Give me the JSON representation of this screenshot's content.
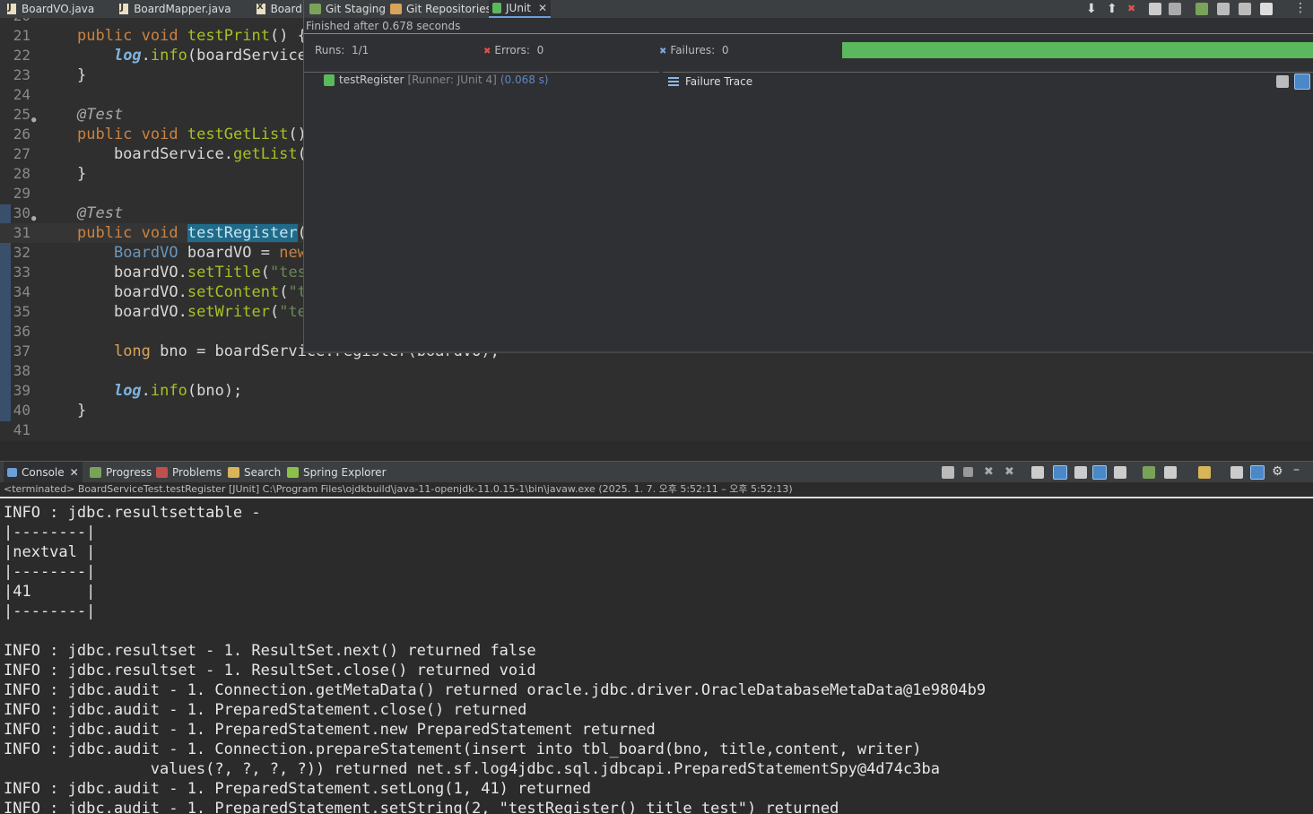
{
  "editor_tabs": [
    {
      "label": "BoardVO.java",
      "icon": "java-file-icon"
    },
    {
      "label": "BoardMapper.java",
      "icon": "java-file-icon"
    },
    {
      "label": "BoardM",
      "icon": "xml-file-icon"
    }
  ],
  "code_lines": [
    {
      "n": "20",
      "html": ""
    },
    {
      "n": "21",
      "parts": [
        [
          "kw",
          "public "
        ],
        [
          "kw",
          "void "
        ],
        [
          "fn",
          "testPrint"
        ],
        [
          "",
          "() {"
        ]
      ]
    },
    {
      "n": "22",
      "parts": [
        [
          "",
          "    "
        ],
        [
          "lg",
          "log"
        ],
        [
          "",
          "."
        ],
        [
          "fn",
          "info"
        ],
        [
          "",
          "(boardService"
        ]
      ]
    },
    {
      "n": "23",
      "parts": [
        [
          "",
          "}"
        ]
      ]
    },
    {
      "n": "24",
      "parts": []
    },
    {
      "n": "25",
      "parts": [
        [
          "an",
          "@Test"
        ]
      ],
      "fold": true
    },
    {
      "n": "26",
      "parts": [
        [
          "kw",
          "public "
        ],
        [
          "kw",
          "void "
        ],
        [
          "fn",
          "testGetList"
        ],
        [
          "",
          "()"
        ]
      ]
    },
    {
      "n": "27",
      "parts": [
        [
          "",
          "    boardService."
        ],
        [
          "fn",
          "getList"
        ],
        [
          "",
          "("
        ]
      ]
    },
    {
      "n": "28",
      "parts": [
        [
          "",
          "}"
        ]
      ]
    },
    {
      "n": "29",
      "parts": []
    },
    {
      "n": "30",
      "parts": [
        [
          "an",
          "@Test"
        ]
      ],
      "fold": true
    },
    {
      "n": "31",
      "parts": [
        [
          "kw",
          "public "
        ],
        [
          "kw",
          "void "
        ],
        [
          "hl",
          "testRegister"
        ],
        [
          "",
          "("
        ]
      ],
      "current": true
    },
    {
      "n": "32",
      "parts": [
        [
          "",
          "    "
        ],
        [
          "ty",
          "BoardVO "
        ],
        [
          "",
          "boardVO = "
        ],
        [
          "kw",
          "new"
        ]
      ]
    },
    {
      "n": "33",
      "parts": [
        [
          "",
          "    boardVO."
        ],
        [
          "fn",
          "setTitle"
        ],
        [
          "",
          "("
        ],
        [
          "str",
          "\"tes"
        ]
      ]
    },
    {
      "n": "34",
      "parts": [
        [
          "",
          "    boardVO."
        ],
        [
          "fn",
          "setContent"
        ],
        [
          "",
          "("
        ],
        [
          "str",
          "\"t"
        ]
      ]
    },
    {
      "n": "35",
      "parts": [
        [
          "",
          "    boardVO."
        ],
        [
          "fn",
          "setWriter"
        ],
        [
          "",
          "("
        ],
        [
          "str",
          "\"te"
        ]
      ]
    },
    {
      "n": "36",
      "parts": []
    },
    {
      "n": "37",
      "parts": [
        [
          "",
          "    "
        ],
        [
          "kw2",
          "long "
        ],
        [
          "",
          "bno = boardService.register(boardVO);"
        ]
      ]
    },
    {
      "n": "38",
      "parts": []
    },
    {
      "n": "39",
      "parts": [
        [
          "",
          "    "
        ],
        [
          "lg",
          "log"
        ],
        [
          "",
          "."
        ],
        [
          "fn",
          "info"
        ],
        [
          "",
          "(bno);"
        ]
      ]
    },
    {
      "n": "40",
      "parts": [
        [
          "",
          "}"
        ]
      ]
    },
    {
      "n": "41",
      "parts": []
    }
  ],
  "junit": {
    "tabs": [
      "Git Staging",
      "Git Repositories",
      "JUnit"
    ],
    "status": "Finished after 0.678 seconds",
    "runs_label": "Runs:",
    "runs_value": "1/1",
    "errors_label": "Errors:",
    "errors_value": "0",
    "failures_label": "Failures:",
    "failures_value": "0",
    "progress_fraction": 1.0,
    "progress_color": "#5cb85c",
    "test_name": "testRegister",
    "test_runner": "[Runner: JUnit 4]",
    "test_time": "(0.068 s)",
    "trace_label": "Failure Trace"
  },
  "console": {
    "tabs": [
      "Console",
      "Progress",
      "Problems",
      "Search",
      "Spring Explorer"
    ],
    "description": "<terminated> BoardServiceTest.testRegister [JUnit] C:\\Program Files\\ojdkbuild\\java-11-openjdk-11.0.15-1\\bin\\javaw.exe  (2025. 1. 7. 오후 5:52:11 – 오후 5:52:13)",
    "lines": [
      "INFO : jdbc.resultsettable -",
      "|--------|",
      "|nextval |",
      "|--------|",
      "|41      |",
      "|--------|",
      "",
      "INFO : jdbc.resultset - 1. ResultSet.next() returned false",
      "INFO : jdbc.resultset - 1. ResultSet.close() returned void",
      "INFO : jdbc.audit - 1. Connection.getMetaData() returned oracle.jdbc.driver.OracleDatabaseMetaData@1e9804b9",
      "INFO : jdbc.audit - 1. PreparedStatement.close() returned",
      "INFO : jdbc.audit - 1. PreparedStatement.new PreparedStatement returned",
      "INFO : jdbc.audit - 1. Connection.prepareStatement(insert into tbl_board(bno, title,content, writer)",
      "                values(?, ?, ?, ?)) returned net.sf.log4jdbc.sql.jdbcapi.PreparedStatementSpy@4d74c3ba",
      "INFO : jdbc.audit - 1. PreparedStatement.setLong(1, 41) returned",
      "INFO : jdbc.audit - 1. PreparedStatement.setString(2, \"testRegister() title test\") returned"
    ]
  }
}
